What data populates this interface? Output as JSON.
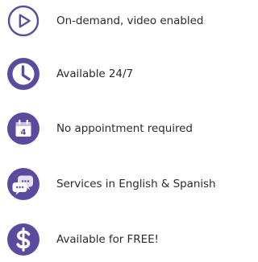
{
  "colors": {
    "icon": "#5b4b9e",
    "icon_light": "#e6def3",
    "text": "#2b2b2b",
    "background": "#ffffff"
  },
  "features": [
    {
      "icon": "play-icon",
      "label": "On-demand, video enabled"
    },
    {
      "icon": "clock-icon",
      "label": "Available 24/7"
    },
    {
      "icon": "calendar-icon",
      "label": "No appointment required",
      "icon_text": "4"
    },
    {
      "icon": "chat-bubbles-icon",
      "label": "Services in English & Spanish"
    },
    {
      "icon": "dollar-icon",
      "label": "Available for FREE!"
    }
  ]
}
